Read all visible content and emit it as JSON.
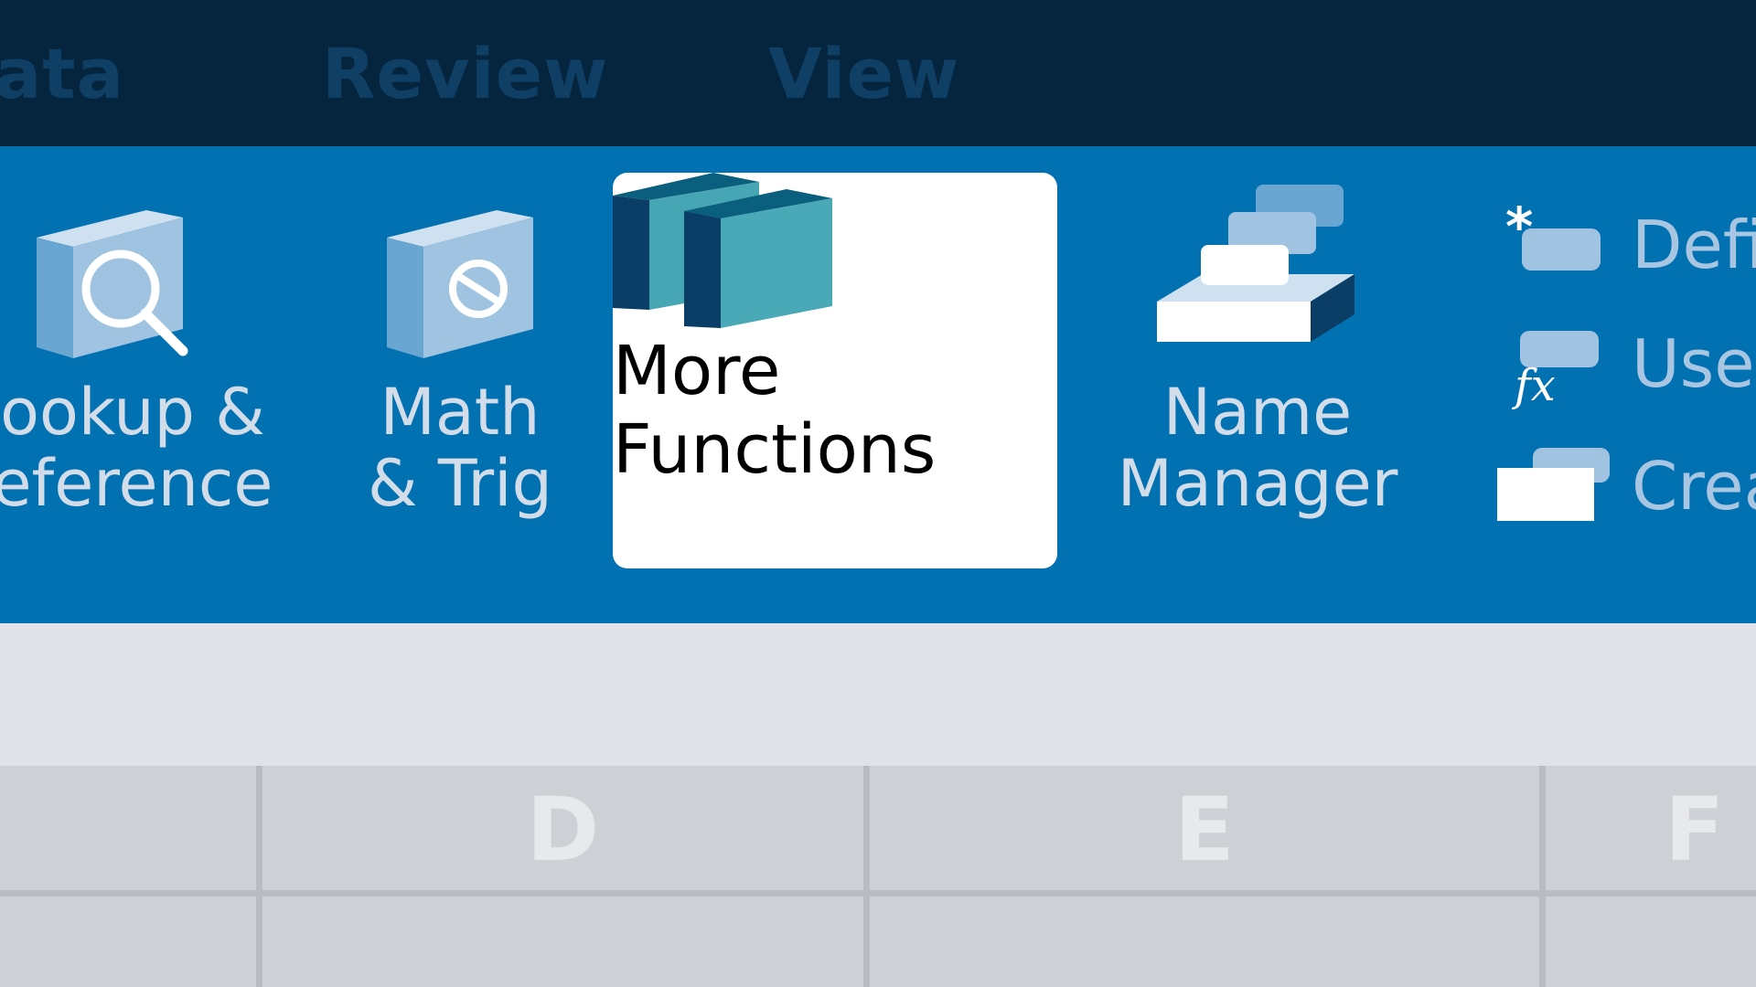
{
  "tabs": [
    {
      "id": "data",
      "label": "ata"
    },
    {
      "id": "review",
      "label": "Review"
    },
    {
      "id": "view",
      "label": "View"
    }
  ],
  "ribbon": {
    "lookup": {
      "line1": "ookup &",
      "line2": "eference",
      "icon": "lookup-book-magnifier-icon"
    },
    "math": {
      "line1": "Math",
      "line2": "& Trig",
      "icon": "math-book-icon"
    },
    "more": {
      "line1": "More",
      "line2": "Functions",
      "icon": "more-functions-books-icon",
      "selected": true
    },
    "name_manager": {
      "line1": "Name",
      "line2": "Manager",
      "icon": "name-manager-icon"
    },
    "defined_names": [
      {
        "label": "Defi",
        "icon": "define-name-icon"
      },
      {
        "label": "Use",
        "icon": "use-in-formula-fx-icon"
      },
      {
        "label": "Crea",
        "icon": "create-from-selection-icon"
      }
    ]
  },
  "grid": {
    "columns": [
      "D",
      "E",
      "F"
    ]
  },
  "colors": {
    "tab_bar": "#04253d",
    "tab_text": "#103f66",
    "ribbon": "#0271b2",
    "ribbon_text": "#d2dde9",
    "selected_card": "#ffffff",
    "formula_bar": "#dfe3e8",
    "grid": "#cdd1d6"
  }
}
